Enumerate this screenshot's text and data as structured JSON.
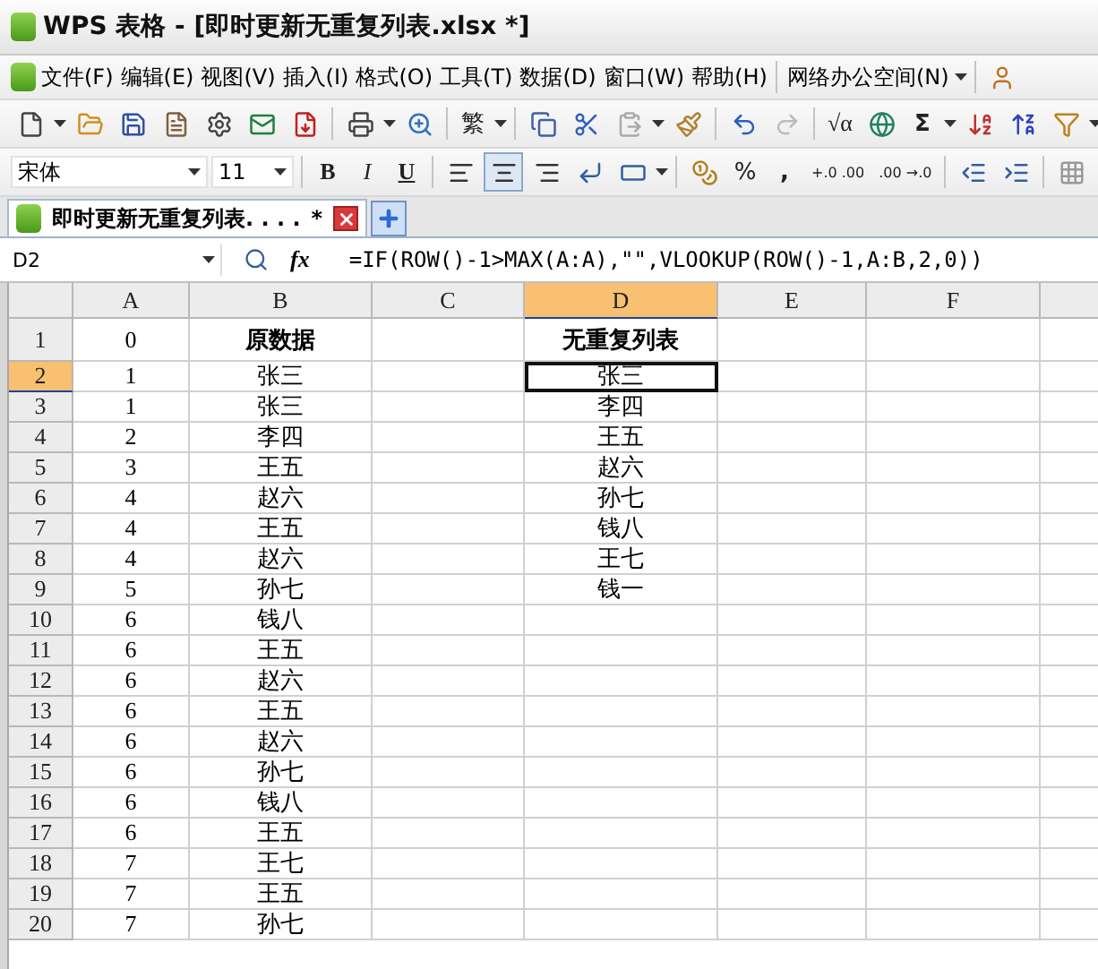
{
  "window": {
    "title": "WPS 表格 - [即时更新无重复列表.xlsx *]"
  },
  "menu": [
    "文件(F)",
    "编辑(E)",
    "视图(V)",
    "插入(I)",
    "格式(O)",
    "工具(T)",
    "数据(D)",
    "窗口(W)",
    "帮助(H)",
    "网络办公空间(N)"
  ],
  "toolbar": {
    "convert_label": "繁",
    "sum_label": "Σ",
    "formula_label": "√α"
  },
  "format_bar": {
    "font": "宋体",
    "size": "11",
    "bold_label": "B",
    "italic_label": "I",
    "underline_label": "U",
    "percent_label": "%",
    "comma_label": ",",
    "increase_decimal_label": "+.0 .00",
    "decrease_decimal_label": ".00 →.0",
    "alignment": [
      {
        "selected": false
      },
      {
        "selected": true
      },
      {
        "selected": false
      }
    ]
  },
  "document_tab": {
    "title": "即时更新无重复列表. . . .",
    "modified_mark": "*",
    "selected": true
  },
  "formula_bar": {
    "name_box": "D2",
    "function_label": "fx",
    "formula": "=IF(ROW()-1>MAX(A:A),\"\",VLOOKUP(ROW()-1,A:B,2,0))"
  },
  "sheet": {
    "columns": [
      {
        "label": "A",
        "selected": false
      },
      {
        "label": "B",
        "selected": false
      },
      {
        "label": "C",
        "selected": false
      },
      {
        "label": "D",
        "selected": true
      },
      {
        "label": "E",
        "selected": false
      },
      {
        "label": "F",
        "selected": false
      }
    ],
    "rows": [
      {
        "header": "1",
        "selected": false,
        "cells": {
          "A": {
            "text": "0",
            "bold": false
          },
          "B": {
            "text": "原数据",
            "bold": true
          },
          "D": {
            "text": "无重复列表",
            "bold": true
          }
        }
      },
      {
        "header": "2",
        "selected": true,
        "cells": {
          "A": {
            "text": "1",
            "bold": false
          },
          "B": {
            "text": "张三",
            "bold": false
          },
          "D": {
            "text": "张三",
            "bold": false
          }
        }
      },
      {
        "header": "3",
        "selected": false,
        "cells": {
          "A": {
            "text": "1",
            "bold": false
          },
          "B": {
            "text": "张三",
            "bold": false
          },
          "D": {
            "text": "李四",
            "bold": false
          }
        }
      },
      {
        "header": "4",
        "selected": false,
        "cells": {
          "A": {
            "text": "2",
            "bold": false
          },
          "B": {
            "text": "李四",
            "bold": false
          },
          "D": {
            "text": "王五",
            "bold": false
          }
        }
      },
      {
        "header": "5",
        "selected": false,
        "cells": {
          "A": {
            "text": "3",
            "bold": false
          },
          "B": {
            "text": "王五",
            "bold": false
          },
          "D": {
            "text": "赵六",
            "bold": false
          }
        }
      },
      {
        "header": "6",
        "selected": false,
        "cells": {
          "A": {
            "text": "4",
            "bold": false
          },
          "B": {
            "text": "赵六",
            "bold": false
          },
          "D": {
            "text": "孙七",
            "bold": false
          }
        }
      },
      {
        "header": "7",
        "selected": false,
        "cells": {
          "A": {
            "text": "4",
            "bold": false
          },
          "B": {
            "text": "王五",
            "bold": false
          },
          "D": {
            "text": "钱八",
            "bold": false
          }
        }
      },
      {
        "header": "8",
        "selected": false,
        "cells": {
          "A": {
            "text": "4",
            "bold": false
          },
          "B": {
            "text": "赵六",
            "bold": false
          },
          "D": {
            "text": "王七",
            "bold": false
          }
        }
      },
      {
        "header": "9",
        "selected": false,
        "cells": {
          "A": {
            "text": "5",
            "bold": false
          },
          "B": {
            "text": "孙七",
            "bold": false
          },
          "D": {
            "text": "钱一",
            "bold": false
          }
        }
      },
      {
        "header": "10",
        "selected": false,
        "cells": {
          "A": {
            "text": "6",
            "bold": false
          },
          "B": {
            "text": "钱八",
            "bold": false
          }
        }
      },
      {
        "header": "11",
        "selected": false,
        "cells": {
          "A": {
            "text": "6",
            "bold": false
          },
          "B": {
            "text": "王五",
            "bold": false
          }
        }
      },
      {
        "header": "12",
        "selected": false,
        "cells": {
          "A": {
            "text": "6",
            "bold": false
          },
          "B": {
            "text": "赵六",
            "bold": false
          }
        }
      },
      {
        "header": "13",
        "selected": false,
        "cells": {
          "A": {
            "text": "6",
            "bold": false
          },
          "B": {
            "text": "王五",
            "bold": false
          }
        }
      },
      {
        "header": "14",
        "selected": false,
        "cells": {
          "A": {
            "text": "6",
            "bold": false
          },
          "B": {
            "text": "赵六",
            "bold": false
          }
        }
      },
      {
        "header": "15",
        "selected": false,
        "cells": {
          "A": {
            "text": "6",
            "bold": false
          },
          "B": {
            "text": "孙七",
            "bold": false
          }
        }
      },
      {
        "header": "16",
        "selected": false,
        "cells": {
          "A": {
            "text": "6",
            "bold": false
          },
          "B": {
            "text": "钱八",
            "bold": false
          }
        }
      },
      {
        "header": "17",
        "selected": false,
        "cells": {
          "A": {
            "text": "6",
            "bold": false
          },
          "B": {
            "text": "王五",
            "bold": false
          }
        }
      },
      {
        "header": "18",
        "selected": false,
        "cells": {
          "A": {
            "text": "7",
            "bold": false
          },
          "B": {
            "text": "王七",
            "bold": false
          }
        }
      },
      {
        "header": "19",
        "selected": false,
        "cells": {
          "A": {
            "text": "7",
            "bold": false
          },
          "B": {
            "text": "王五",
            "bold": false
          }
        }
      },
      {
        "header": "20",
        "selected": false,
        "cells": {
          "A": {
            "text": "7",
            "bold": false
          },
          "B": {
            "text": "孙七",
            "bold": false
          }
        }
      }
    ]
  }
}
